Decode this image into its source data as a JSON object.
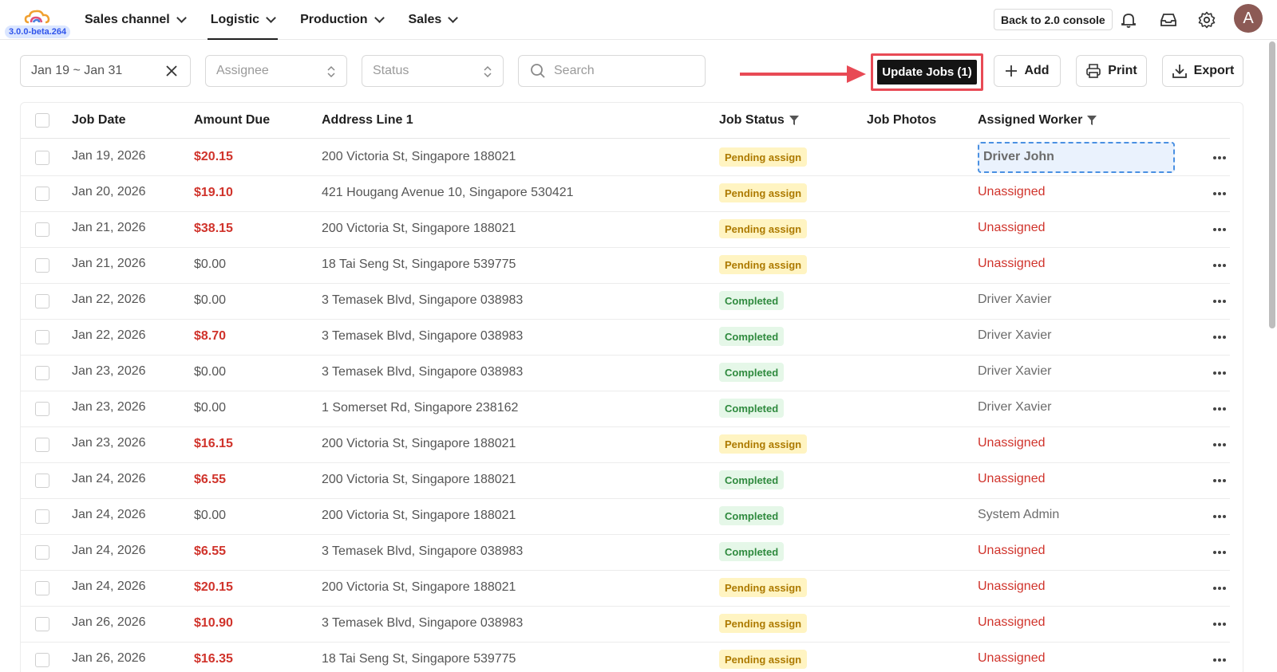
{
  "app": {
    "version": "3.0.0-beta.264",
    "avatar_letter": "A",
    "console_button": "Back to 2.0 console"
  },
  "nav": {
    "items": [
      {
        "label": "Sales channel",
        "active": false
      },
      {
        "label": "Logistic",
        "active": true
      },
      {
        "label": "Production",
        "active": false
      },
      {
        "label": "Sales",
        "active": false
      }
    ]
  },
  "filters": {
    "date_range": "Jan 19 ~ Jan 31",
    "assignee_placeholder": "Assignee",
    "status_placeholder": "Status",
    "search_placeholder": "Search"
  },
  "toolbar": {
    "update_jobs": "Update Jobs (1)",
    "add": "Add",
    "print": "Print",
    "export": "Export"
  },
  "table": {
    "headers": {
      "job_date": "Job Date",
      "amount_due": "Amount Due",
      "address": "Address Line 1",
      "job_status": "Job Status",
      "job_photos": "Job Photos",
      "assigned_worker": "Assigned Worker"
    },
    "rows": [
      {
        "date": "Jan 19, 2026",
        "amount": "$20.15",
        "due": true,
        "address": "200 Victoria St, Singapore 188021",
        "status": "Pending assign",
        "worker": "Driver John",
        "highlight": true
      },
      {
        "date": "Jan 20, 2026",
        "amount": "$19.10",
        "due": true,
        "address": "421 Hougang Avenue 10, Singapore 530421",
        "status": "Pending assign",
        "worker": "Unassigned"
      },
      {
        "date": "Jan 21, 2026",
        "amount": "$38.15",
        "due": true,
        "address": "200 Victoria St, Singapore 188021",
        "status": "Pending assign",
        "worker": "Unassigned"
      },
      {
        "date": "Jan 21, 2026",
        "amount": "$0.00",
        "due": false,
        "address": "18 Tai Seng St, Singapore 539775",
        "status": "Pending assign",
        "worker": "Unassigned"
      },
      {
        "date": "Jan 22, 2026",
        "amount": "$0.00",
        "due": false,
        "address": "3 Temasek Blvd, Singapore 038983",
        "status": "Completed",
        "worker": "Driver Xavier"
      },
      {
        "date": "Jan 22, 2026",
        "amount": "$8.70",
        "due": true,
        "address": "3 Temasek Blvd, Singapore 038983",
        "status": "Completed",
        "worker": "Driver Xavier"
      },
      {
        "date": "Jan 23, 2026",
        "amount": "$0.00",
        "due": false,
        "address": "3 Temasek Blvd, Singapore 038983",
        "status": "Completed",
        "worker": "Driver Xavier"
      },
      {
        "date": "Jan 23, 2026",
        "amount": "$0.00",
        "due": false,
        "address": "1 Somerset Rd, Singapore 238162",
        "status": "Completed",
        "worker": "Driver Xavier"
      },
      {
        "date": "Jan 23, 2026",
        "amount": "$16.15",
        "due": true,
        "address": "200 Victoria St, Singapore 188021",
        "status": "Pending assign",
        "worker": "Unassigned"
      },
      {
        "date": "Jan 24, 2026",
        "amount": "$6.55",
        "due": true,
        "address": "200 Victoria St, Singapore 188021",
        "status": "Completed",
        "worker": "Unassigned"
      },
      {
        "date": "Jan 24, 2026",
        "amount": "$0.00",
        "due": false,
        "address": "200 Victoria St, Singapore 188021",
        "status": "Completed",
        "worker": "System Admin"
      },
      {
        "date": "Jan 24, 2026",
        "amount": "$6.55",
        "due": true,
        "address": "3 Temasek Blvd, Singapore 038983",
        "status": "Completed",
        "worker": "Unassigned"
      },
      {
        "date": "Jan 24, 2026",
        "amount": "$20.15",
        "due": true,
        "address": "200 Victoria St, Singapore 188021",
        "status": "Pending assign",
        "worker": "Unassigned"
      },
      {
        "date": "Jan 26, 2026",
        "amount": "$10.90",
        "due": true,
        "address": "3 Temasek Blvd, Singapore 038983",
        "status": "Pending assign",
        "worker": "Unassigned"
      },
      {
        "date": "Jan 26, 2026",
        "amount": "$16.35",
        "due": true,
        "address": "18 Tai Seng St, Singapore 539775",
        "status": "Pending assign",
        "worker": "Unassigned"
      }
    ]
  },
  "colors": {
    "due_red": "#d0332b",
    "highlight_red": "#e84a55",
    "pending_bg": "#fff4c2",
    "completed_bg": "#e5f7e8"
  }
}
